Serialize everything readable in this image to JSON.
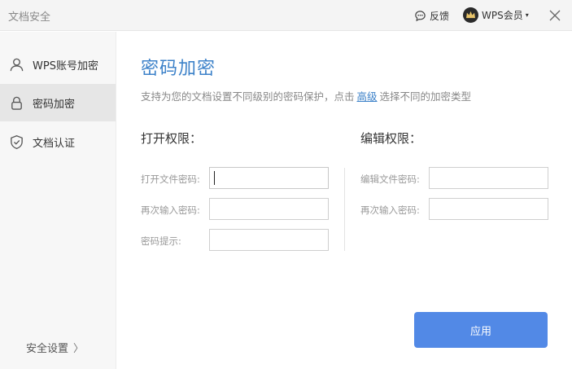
{
  "window": {
    "title": "文档安全"
  },
  "header": {
    "feedback_label": "反馈",
    "vip_label": "WPS会员",
    "caret": "▾"
  },
  "sidebar": {
    "items": [
      {
        "label": "WPS账号加密",
        "icon": "user-icon",
        "active": false
      },
      {
        "label": "密码加密",
        "icon": "lock-icon",
        "active": true
      },
      {
        "label": "文档认证",
        "icon": "shield-check-icon",
        "active": false
      }
    ],
    "security_settings_label": "安全设置",
    "security_chevron": "〉"
  },
  "main": {
    "heading": "密码加密",
    "description_prefix": "支持为您的文档设置不同级别的密码保护，点击",
    "description_link": "高级",
    "description_suffix": "选择不同的加密类型",
    "open_section": {
      "title": "打开权限：",
      "password_label": "打开文件密码:",
      "confirm_label": "再次输入密码:",
      "hint_label": "密码提示:",
      "password_value": "",
      "confirm_value": "",
      "hint_value": ""
    },
    "edit_section": {
      "title": "编辑权限：",
      "password_label": "编辑文件密码:",
      "confirm_label": "再次输入密码:",
      "password_value": "",
      "confirm_value": ""
    },
    "apply_label": "应用"
  },
  "colors": {
    "accent": "#3d82c9",
    "button": "#5289e6",
    "sidebar_bg": "#f7f7f7",
    "active_bg": "#e6e6e6"
  }
}
